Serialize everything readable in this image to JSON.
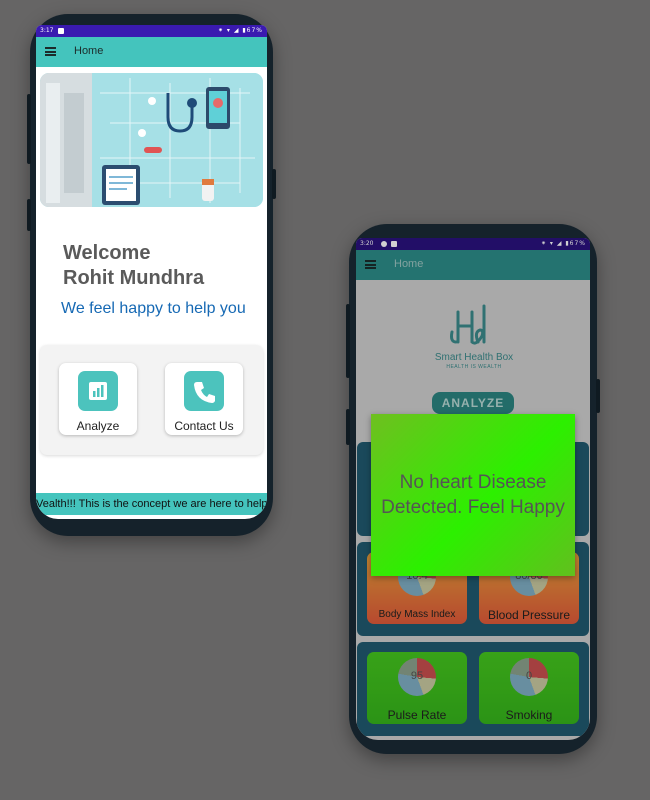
{
  "phone_left": {
    "status": {
      "time": "3:17",
      "right": "⁕ ▾ ◢ ▮67%"
    },
    "appbar": {
      "title": "Home"
    },
    "welcome": {
      "line1": "Welcome",
      "line2": "Rohit Mundhra"
    },
    "tagline": "We feel happy to help you",
    "cards": [
      {
        "label": "Analyze",
        "icon": "chart-icon"
      },
      {
        "label": "Contact Us",
        "icon": "phone-icon"
      }
    ],
    "marquee": "Vealth!!! This is the concept we are here to help y"
  },
  "phone_right": {
    "status": {
      "time": "3:20",
      "right": "⁕ ▾ ◢ ▮67%"
    },
    "appbar": {
      "title": "Home"
    },
    "logo": {
      "name": "Smart Health Box",
      "tagline": "HEALTH IS WEALTH"
    },
    "analyze_label": "ANALYZE",
    "tiles": [
      {
        "value": "10.4",
        "label": "Body Mass Index"
      },
      {
        "value": "80/80",
        "label": "Blood Pressure"
      },
      {
        "value": "95",
        "label": "Pulse Rate"
      },
      {
        "value": "0",
        "label": "Smoking"
      }
    ],
    "toast": {
      "message": "No heart Disease Detected. Feel Happy"
    }
  },
  "colors": {
    "accent": "#44c4bd",
    "status_bar": "#3a1ab0",
    "tagline": "#1669b4",
    "toast": "#2cf000"
  }
}
